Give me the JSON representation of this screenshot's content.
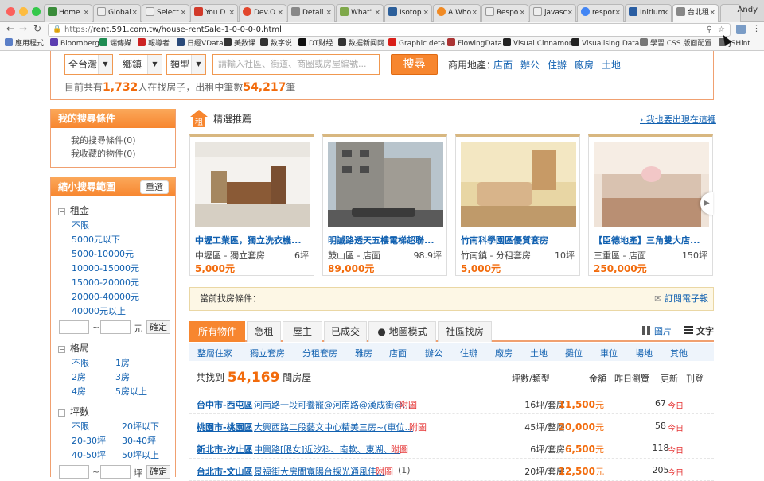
{
  "browser": {
    "tabs": [
      {
        "title": "Home",
        "color": "#3a8c3a"
      },
      {
        "title": "Global",
        "color": "#bbbbbb"
      },
      {
        "title": "Select",
        "color": "#bbbbbb"
      },
      {
        "title": "You D",
        "color": "#d23a2a"
      },
      {
        "title": "Dev.O",
        "color": "#e2462c"
      },
      {
        "title": "Detail",
        "color": "#888888"
      },
      {
        "title": "What'",
        "color": "#7fa84a"
      },
      {
        "title": "Isotop",
        "color": "#2c5f9a"
      },
      {
        "title": "A Who",
        "color": "#f08a24"
      },
      {
        "title": "Respo",
        "color": "#bbbbbb"
      },
      {
        "title": "javasc",
        "color": "#bbbbbb"
      },
      {
        "title": "respor",
        "color": "#4285f4"
      },
      {
        "title": "Initium",
        "color": "#2b5fa3"
      },
      {
        "title": "台北租",
        "color": "#888888"
      }
    ],
    "user": "Andy",
    "url_scheme": "https://",
    "url_rest": "rent.591.com.tw/house-rentSale-1-0-0-0-0.html",
    "bookmarks": [
      {
        "label": "應用程式",
        "color": "#5b7fc7"
      },
      {
        "label": "Bloomberg",
        "color": "#5b3db0"
      },
      {
        "label": "端傳媒",
        "color": "#1f8c52"
      },
      {
        "label": "報導者",
        "color": "#cc2222"
      },
      {
        "label": "日經VData",
        "color": "#2a4a7a"
      },
      {
        "label": "美数课",
        "color": "#333333"
      },
      {
        "label": "数字说",
        "color": "#333333"
      },
      {
        "label": "DT财经",
        "color": "#111111"
      },
      {
        "label": "数据新闻网",
        "color": "#333333"
      },
      {
        "label": "Graphic detail",
        "color": "#d91e18"
      },
      {
        "label": "FlowingData",
        "color": "#a33"
      },
      {
        "label": "Visual Cinnamon",
        "color": "#222222"
      },
      {
        "label": "Visualising Data",
        "color": "#222222"
      },
      {
        "label": "學習 CSS 版面配置",
        "color": "#777777"
      },
      {
        "label": "JSHint",
        "color": "#666666"
      }
    ]
  },
  "search": {
    "region": "全台灣",
    "town": "鄉鎮",
    "type": "類型",
    "keyword_placeholder": "請輸入社區、街道、商圈或房屋編號...",
    "button": "搜尋",
    "biz_label": "商用地產：",
    "biz_links": [
      "店面",
      "辦公",
      "住辦",
      "廠房",
      "土地"
    ],
    "stat_prefix": "目前共有",
    "people": "1,732",
    "stat_mid": "人在找房子，出租中筆數",
    "listings": "54,217",
    "stat_suffix": "筆"
  },
  "my_search": {
    "title": "我的搜尋條件",
    "items": [
      "我的搜尋條件(0)",
      "我收藏的物件(0)"
    ]
  },
  "filter": {
    "title": "縮小搜尋範圍",
    "reset": "重選",
    "rent_title": "租金",
    "rent_options": [
      "不限",
      "5000元以下",
      "5000-10000元",
      "10000-15000元",
      "15000-20000元",
      "20000-40000元",
      "40000元以上"
    ],
    "tilde": "~",
    "unit_yuan": "元",
    "confirm": "確定",
    "room_title": "格局",
    "room_options": [
      "不限",
      "1房",
      "2房",
      "3房",
      "4房",
      "5房以上"
    ],
    "size_title": "坪數",
    "size_options": [
      "不限",
      "20坪以下",
      "20-30坪",
      "30-40坪",
      "40-50坪",
      "50坪以上"
    ],
    "unit_ping": "坪"
  },
  "featured": {
    "icon_text": "租",
    "title": "精選推薦",
    "more": "我也要出現在這裡",
    "cards": [
      {
        "title": "中壢工業區，獨立洗衣機...",
        "location": "中壢區 - 獨立套房",
        "size": "6坪",
        "price": "5,000元"
      },
      {
        "title": "明誠路透天五樓電梯超聯...",
        "location": "鼓山區 - 店面",
        "size": "98.9坪",
        "price": "89,000元"
      },
      {
        "title": "竹南科學園區優質套房",
        "location": "竹南鎮 - 分租套房",
        "size": "10坪",
        "price": "5,000元"
      },
      {
        "title": "【臣德地產】三角雙大店...",
        "location": "三重區 - 店面",
        "size": "150坪",
        "price": "250,000元"
      }
    ]
  },
  "conditions": {
    "label": "當前找房條件：",
    "subscribe": "訂閱電子報"
  },
  "tabs": [
    "所有物件",
    "急租",
    "屋主",
    "已成交",
    "地圖模式",
    "社區找房"
  ],
  "view": {
    "grid": "圖片",
    "text": "文字"
  },
  "types": [
    "整層住家",
    "獨立套房",
    "分租套房",
    "雅房",
    "店面",
    "辦公",
    "住辦",
    "廠房",
    "土地",
    "攤位",
    "車位",
    "場地",
    "其他"
  ],
  "results": {
    "prefix": "共找到",
    "count": "54,169",
    "suffix": "間房屋",
    "col_size": "坪數/類型",
    "col_price": "金額",
    "col_views": "昨日瀏覽",
    "col_update": "更新",
    "col_date": "刊登"
  },
  "rows": [
    {
      "city": "台中市",
      "dist": "西屯區",
      "title": "河南路一段可養寵@河南路@漢成街@...",
      "attach": "附圖",
      "count": "",
      "size": "16坪/套房",
      "price": "11,500",
      "unit": "元",
      "views": "67",
      "date": "今日"
    },
    {
      "city": "桃園市",
      "dist": "桃園區",
      "title": "大興西路二段藝文中心精美三房~(車位...",
      "attach": "附圖",
      "count": "",
      "size": "45坪/整層",
      "price": "20,000",
      "unit": "元",
      "views": "58",
      "date": "今日"
    },
    {
      "city": "新北市",
      "dist": "汐止區",
      "title": "中興路[限女]近汐科、南軟、東湖、...",
      "attach": "附圖",
      "count": "",
      "size": "6坪/套房",
      "price": "6,500",
      "unit": "元",
      "views": "118",
      "date": "今日"
    },
    {
      "city": "台北市",
      "dist": "文山區",
      "title": "景福街大房間寬陽台採光通風佳...",
      "attach": "附圖",
      "count": "(1)",
      "size": "20坪/套房",
      "price": "12,500",
      "unit": "元",
      "views": "205",
      "date": "今日"
    }
  ]
}
